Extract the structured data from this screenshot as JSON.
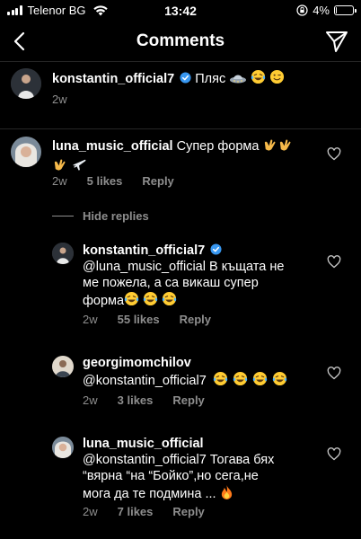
{
  "status": {
    "carrier": "Telenor BG",
    "time": "13:42",
    "battery": "4%",
    "battery_level": 0.04
  },
  "nav": {
    "title": "Comments"
  },
  "caption": {
    "username": "konstantin_official7",
    "text": "Пляс",
    "time": "2w",
    "emojis": [
      "ufo-icon",
      "laughing-tears-emoji",
      "wink-emoji"
    ]
  },
  "comments": [
    {
      "username": "luna_music_official",
      "text_line1": "Супер форма",
      "time": "2w",
      "likes": "5 likes",
      "reply": "Reply"
    }
  ],
  "hide_replies": "Hide replies",
  "replies": [
    {
      "username": "konstantin_official7",
      "line1": "@luna_music_official В къщата не",
      "line2": "ме пожела, а са викаш супер",
      "line3": "форма",
      "time": "2w",
      "likes": "55 likes",
      "reply": "Reply"
    },
    {
      "username": "georgimomchilov",
      "line1": "@konstantin_official7",
      "time": "2w",
      "likes": "3 likes",
      "reply": "Reply"
    },
    {
      "username": "luna_music_official",
      "line1": "@konstantin_official7 Тогава бях",
      "line2": "“вярна “на “Бойко”,но сега,не",
      "line3": "мога да те подмина ...",
      "time": "2w",
      "likes": "7 likes",
      "reply": "Reply"
    }
  ],
  "colors": {
    "background": "#000000",
    "secondary_text": "#8e8e8e",
    "verified_blue": "#3897f0",
    "divider": "#262626"
  }
}
